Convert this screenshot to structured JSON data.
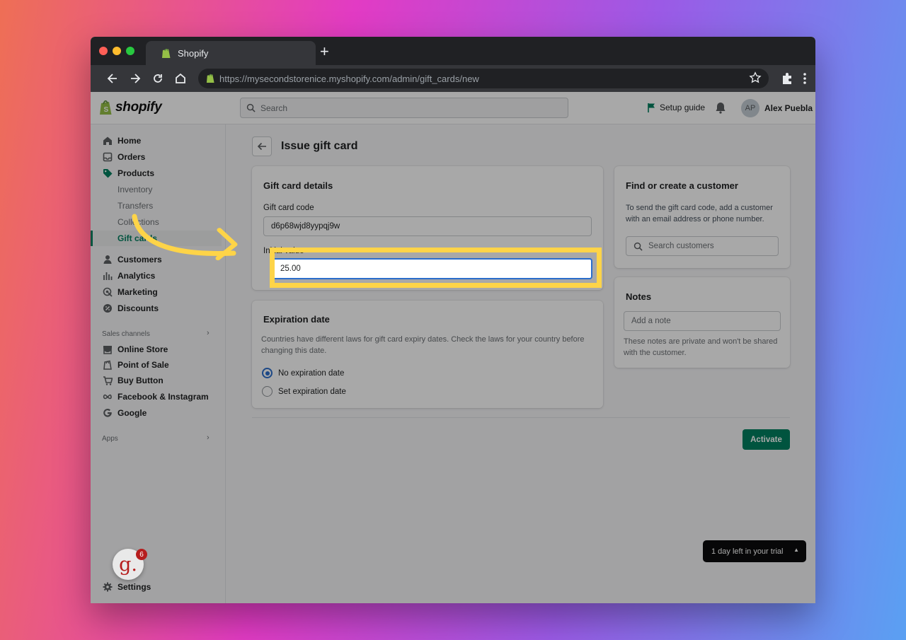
{
  "browser": {
    "tab_title": "Shopify",
    "new_tab": "+",
    "url": "https://mysecondstorenice.myshopify.com/admin/gift_cards/new"
  },
  "topbar": {
    "logo_text": "shopify",
    "search_placeholder": "Search",
    "setup_guide": "Setup guide",
    "avatar_initials": "AP",
    "user_name": "Alex Puebla"
  },
  "sidebar": {
    "items": [
      {
        "label": "Home",
        "icon": "home-icon"
      },
      {
        "label": "Orders",
        "icon": "orders-icon"
      },
      {
        "label": "Products",
        "icon": "tag-icon"
      },
      {
        "label": "Inventory"
      },
      {
        "label": "Transfers"
      },
      {
        "label": "Collections"
      },
      {
        "label": "Gift cards"
      },
      {
        "label": "Customers",
        "icon": "person-icon"
      },
      {
        "label": "Analytics",
        "icon": "bar-chart-icon"
      },
      {
        "label": "Marketing",
        "icon": "target-icon"
      },
      {
        "label": "Discounts",
        "icon": "discount-icon"
      }
    ],
    "sales_channels_label": "Sales channels",
    "channels": [
      {
        "label": "Online Store",
        "icon": "store-icon"
      },
      {
        "label": "Point of Sale",
        "icon": "pos-icon"
      },
      {
        "label": "Buy Button",
        "icon": "buy-button-icon"
      },
      {
        "label": "Facebook & Instagram",
        "icon": "infinity-icon"
      },
      {
        "label": "Google",
        "icon": "google-icon"
      }
    ],
    "apps_label": "Apps",
    "settings": "Settings",
    "growth_badge_letter": "g.",
    "growth_badge_count": "6"
  },
  "page": {
    "title": "Issue gift card",
    "details_card": {
      "title": "Gift card details",
      "code_label": "Gift card code",
      "code_value": "d6p68wjd8yypqj9w",
      "initial_value_label": "Initial value",
      "initial_value": "25.00"
    },
    "expiration_card": {
      "title": "Expiration date",
      "help": "Countries have different laws for gift card expiry dates. Check the laws for your country before changing this date.",
      "options": [
        "No expiration date",
        "Set expiration date"
      ],
      "selected": "No expiration date"
    },
    "customer_card": {
      "title": "Find or create a customer",
      "help": "To send the gift card code, add a customer with an email address or phone number.",
      "search_placeholder": "Search customers"
    },
    "notes_card": {
      "title": "Notes",
      "placeholder": "Add a note",
      "help": "These notes are private and won't be shared with the customer."
    },
    "activate_button": "Activate",
    "trial_banner": "1 day left in your trial"
  },
  "colors": {
    "accent_green": "#008060",
    "highlight_yellow": "#fed448",
    "focus_blue": "#2c6ecb"
  }
}
